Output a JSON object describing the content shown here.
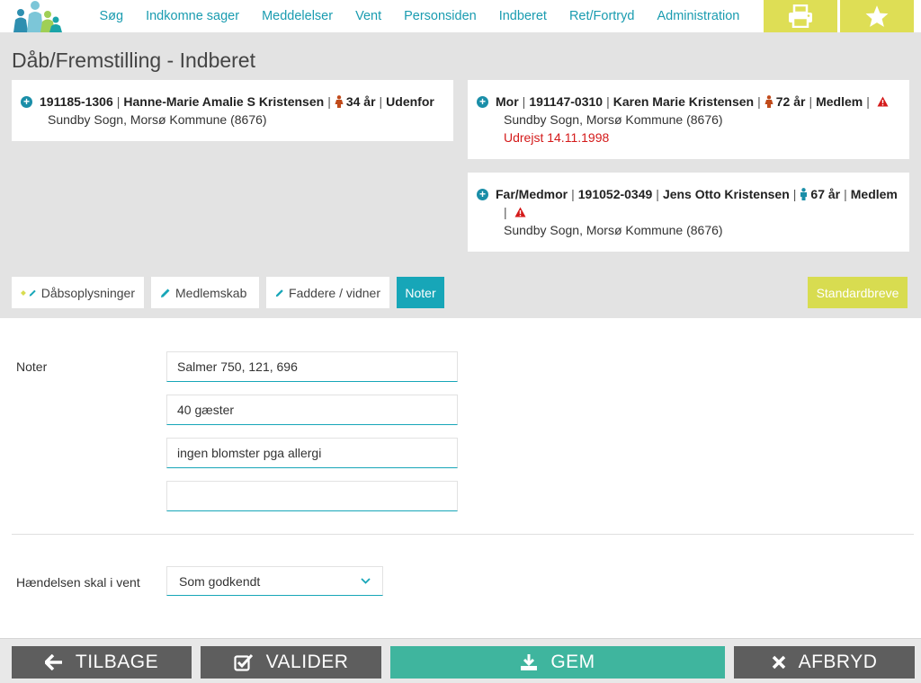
{
  "nav": {
    "items": [
      "Søg",
      "Indkomne sager",
      "Meddelelser",
      "Vent",
      "Personsiden",
      "Indberet",
      "Ret/Fortryd",
      "Administration"
    ]
  },
  "icons": {
    "print": "print-icon",
    "star": "star-icon",
    "plus": "plus-circle-icon",
    "warning": "warning-icon"
  },
  "colors": {
    "accent": "#17a6b8",
    "yellow": "#dede55",
    "save": "#3fb59e",
    "dark_button": "#5e5e5e",
    "alert": "#d41a1a"
  },
  "page": {
    "title": "Dåb/Fremstilling - Indberet"
  },
  "child": {
    "cpr": "191185-1306",
    "name": "Hanne-Marie Amalie S Kristensen",
    "age": "34 år",
    "status": "Udenfor",
    "parish": "Sundby Sogn, Morsø Kommune (8676)"
  },
  "mother": {
    "role": "Mor",
    "cpr": "191147-0310",
    "name": "Karen Marie Kristensen",
    "age": "72 år",
    "status": "Medlem",
    "parish": "Sundby Sogn, Morsø Kommune (8676)",
    "note": "Udrejst 14.11.1998"
  },
  "father": {
    "role": "Far/Medmor",
    "cpr": "191052-0349",
    "name": "Jens Otto Kristensen",
    "age": "67 år",
    "status": "Medlem",
    "parish": "Sundby Sogn, Morsø Kommune (8676)"
  },
  "tabs": {
    "t1": "Dåbsoplysninger",
    "t2": "Medlemskab",
    "t3": "Faddere / vidner",
    "t4": "Noter"
  },
  "standard_letters": "Standardbreve",
  "notes": {
    "label": "Noter",
    "values": [
      "Salmer 750, 121, 696",
      "40 gæster",
      "ingen blomster pga allergi",
      ""
    ]
  },
  "wait": {
    "label": "Hændelsen skal i vent",
    "selected": "Som godkendt"
  },
  "buttons": {
    "back": "TILBAGE",
    "validate": "VALIDER",
    "save": "GEM",
    "cancel": "AFBRYD"
  }
}
